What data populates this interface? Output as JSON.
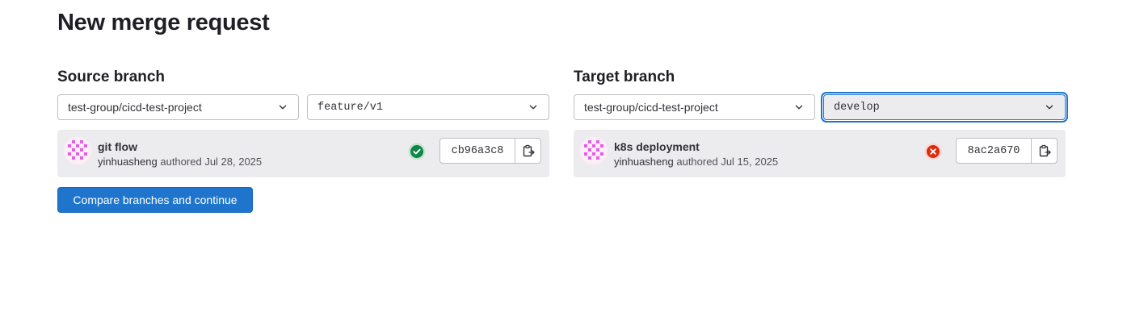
{
  "page": {
    "title": "New merge request"
  },
  "colors": {
    "accent": "#1f75cb",
    "success": "#108548",
    "danger": "#dd2b0e"
  },
  "source": {
    "heading": "Source branch",
    "project": "test-group/cicd-test-project",
    "branch": "feature/v1",
    "commit": {
      "title": "git flow",
      "author": "yinhuasheng",
      "authored_label": "authored",
      "date": "Jul 28, 2025",
      "sha": "cb96a3c8",
      "status": "success",
      "status_icon": "check-circle-icon"
    }
  },
  "target": {
    "heading": "Target branch",
    "project": "test-group/cicd-test-project",
    "branch": "develop",
    "commit": {
      "title": "k8s deployment",
      "author": "yinhuasheng",
      "authored_label": "authored",
      "date": "Jul 15, 2025",
      "sha": "8ac2a670",
      "status": "failed",
      "status_icon": "x-circle-icon"
    }
  },
  "actions": {
    "compare_label": "Compare branches and continue"
  }
}
